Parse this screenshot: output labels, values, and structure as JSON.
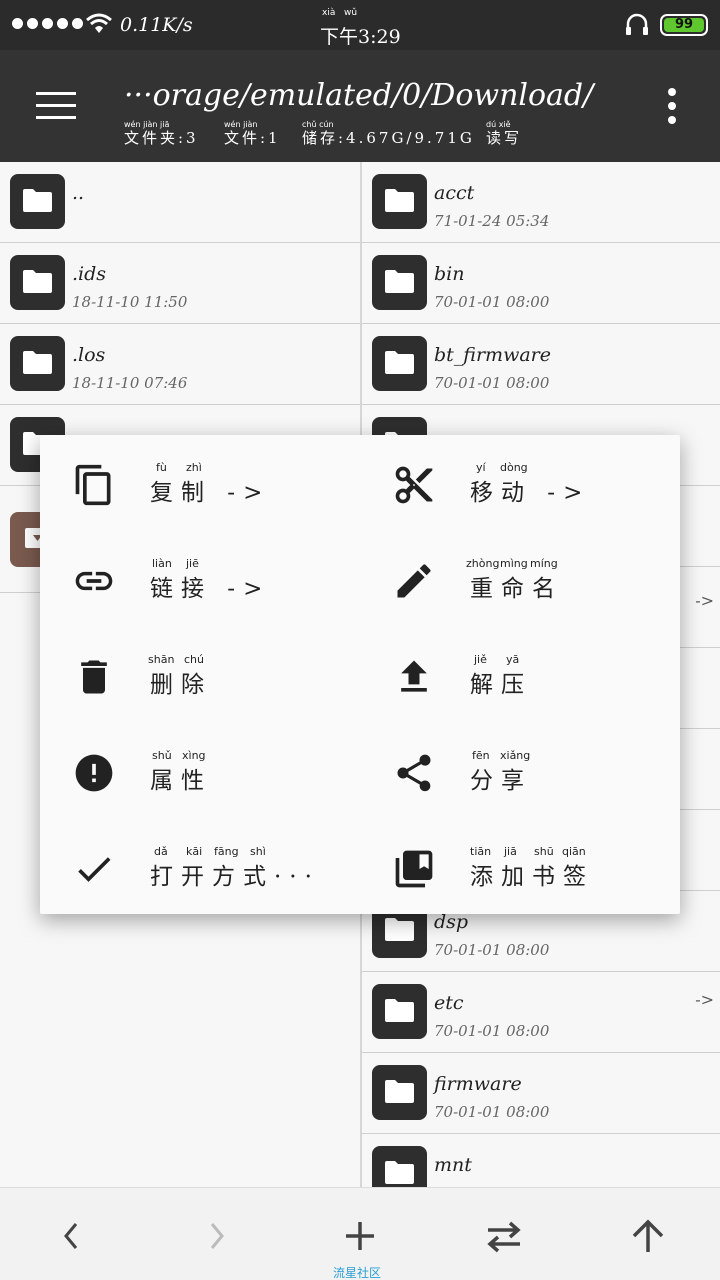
{
  "status": {
    "net_speed": "0.11K/s",
    "time": "下午3:29",
    "time_pinyin": [
      "xià",
      "wǔ"
    ],
    "battery": "99"
  },
  "appbar": {
    "path": "···orage/emulated/0/Download/",
    "info": [
      {
        "text": "文件夹:3",
        "pinyin": "wén  jiàn  jiā"
      },
      {
        "text": "文件:1",
        "pinyin": "wén  jiàn"
      },
      {
        "text": "储存:4.67G/9.71G",
        "pinyin": "chǔ  cún"
      },
      {
        "text": "读写",
        "pinyin": "dú  xiě"
      }
    ]
  },
  "left_files": [
    {
      "name": "..",
      "date": "",
      "icon": "folder-icon"
    },
    {
      "name": ".ids",
      "date": "18-11-10 11:50",
      "icon": "folder-icon"
    },
    {
      "name": ".los",
      "date": "18-11-10 07:46",
      "icon": "folder-icon"
    },
    {
      "name": "",
      "date": "",
      "icon": "folder-icon"
    },
    {
      "name": "",
      "date": "",
      "icon": "archive-icon"
    }
  ],
  "right_files": [
    {
      "name": "acct",
      "date": "71-01-24 05:34"
    },
    {
      "name": "bin",
      "date": "70-01-01 08:00"
    },
    {
      "name": "bt_firmware",
      "date": "70-01-01 08:00"
    },
    {
      "name": "",
      "date": ""
    },
    {
      "name": "",
      "date": ""
    },
    {
      "name": "",
      "date": "",
      "arrow": "->"
    },
    {
      "name": "",
      "date": ""
    },
    {
      "name": "",
      "date": ""
    },
    {
      "name": "",
      "date": ""
    },
    {
      "name": "dsp",
      "date": "70-01-01 08:00"
    },
    {
      "name": "etc",
      "date": "70-01-01 08:00",
      "arrow": "->"
    },
    {
      "name": "firmware",
      "date": "70-01-01 08:00"
    },
    {
      "name": "mnt",
      "date": ""
    }
  ],
  "context_menu": {
    "copy": {
      "label": "复制 ->",
      "pinyin": [
        "fù",
        "zhì"
      ]
    },
    "move": {
      "label": "移动 ->",
      "pinyin": [
        "yí",
        "dòng"
      ]
    },
    "link": {
      "label": "链接 ->",
      "pinyin": [
        "liàn",
        "jiē"
      ]
    },
    "rename": {
      "label": "重命名",
      "pinyin": [
        "zhòng",
        "mìng",
        "míng"
      ]
    },
    "delete": {
      "label": "删除",
      "pinyin": [
        "shān",
        "chú"
      ]
    },
    "extract": {
      "label": "解压",
      "pinyin": [
        "jiě",
        "yā"
      ]
    },
    "properties": {
      "label": "属性",
      "pinyin": [
        "shǔ",
        "xìng"
      ]
    },
    "share": {
      "label": "分享",
      "pinyin": [
        "fēn",
        "xiǎng"
      ]
    },
    "open_with": {
      "label": "打开方式···",
      "pinyin": [
        "dǎ",
        "kāi",
        "fāng",
        "shì"
      ]
    },
    "bookmark": {
      "label": "添加书签",
      "pinyin": [
        "tiān",
        "jiā",
        "shū",
        "qiān"
      ]
    }
  },
  "watermark": "流星社区",
  "colors": {
    "appbar": "#333333",
    "battery": "#5ec82e",
    "watermark": "#2a9fd6"
  }
}
